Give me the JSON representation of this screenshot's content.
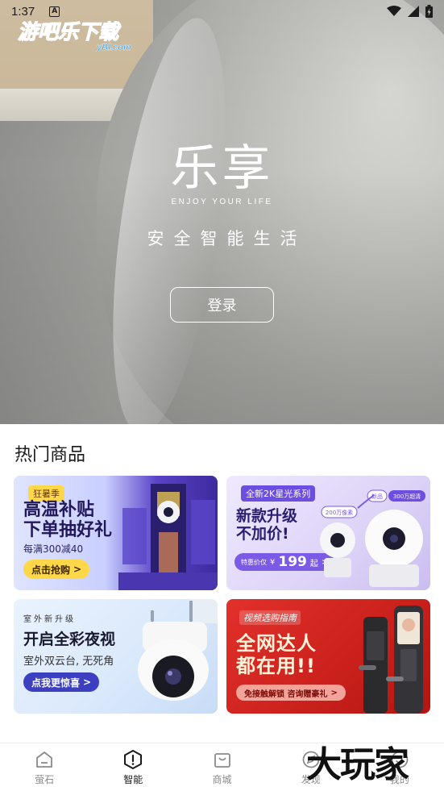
{
  "status_bar": {
    "time": "1:37",
    "notification_letter": "A"
  },
  "watermark": {
    "brand": "游吧乐下载",
    "domain": "yBl.com"
  },
  "hero": {
    "title": "乐享",
    "subtitle": "ENJOY YOUR LIFE",
    "slogan": "安全智能生活",
    "login_label": "登录"
  },
  "section": {
    "title": "热门商品"
  },
  "cards": [
    {
      "tag": "狂暑季",
      "headline_line1": "高温补贴",
      "headline_line2": "下单抽好礼",
      "sub": "每满300减40",
      "cta": "点击抢购",
      "cta_arrow": ">"
    },
    {
      "tag": "全新2K星光系列",
      "headline_line1": "新款升级",
      "headline_line2": "不加价!",
      "price_label": "特惠价仅",
      "price_symbol": "¥",
      "price_value": "199",
      "price_suffix": "起",
      "price_arrow": ">",
      "badge_left": "200万像素",
      "badge_new": "新品",
      "badge_right": "300万超清"
    },
    {
      "kicker": "室外新升级",
      "headline": "开启全彩夜视",
      "sub": "室外双云台, 无死角",
      "cta": "点我更惊喜",
      "cta_arrow": ">"
    },
    {
      "kicker": "视频选购指南",
      "headline_line1": "全网达人",
      "headline_line2": "都在用!!",
      "cta": "免接触解锁 咨询赠豪礼",
      "cta_arrow": ">"
    }
  ],
  "nav": {
    "items": [
      {
        "label": "萤石",
        "icon": "home-icon",
        "active": false
      },
      {
        "label": "智能",
        "icon": "smart-icon",
        "active": true
      },
      {
        "label": "商城",
        "icon": "shop-bag-icon",
        "active": false
      },
      {
        "label": "发现",
        "icon": "discover-icon",
        "active": false
      },
      {
        "label": "我的",
        "icon": "profile-icon",
        "active": false
      }
    ]
  },
  "corner_watermark": "大玩家",
  "colors": {
    "accent": "#6c4ee0",
    "active_nav": "#1a1a1a",
    "inactive_nav": "#8a8a8a"
  }
}
